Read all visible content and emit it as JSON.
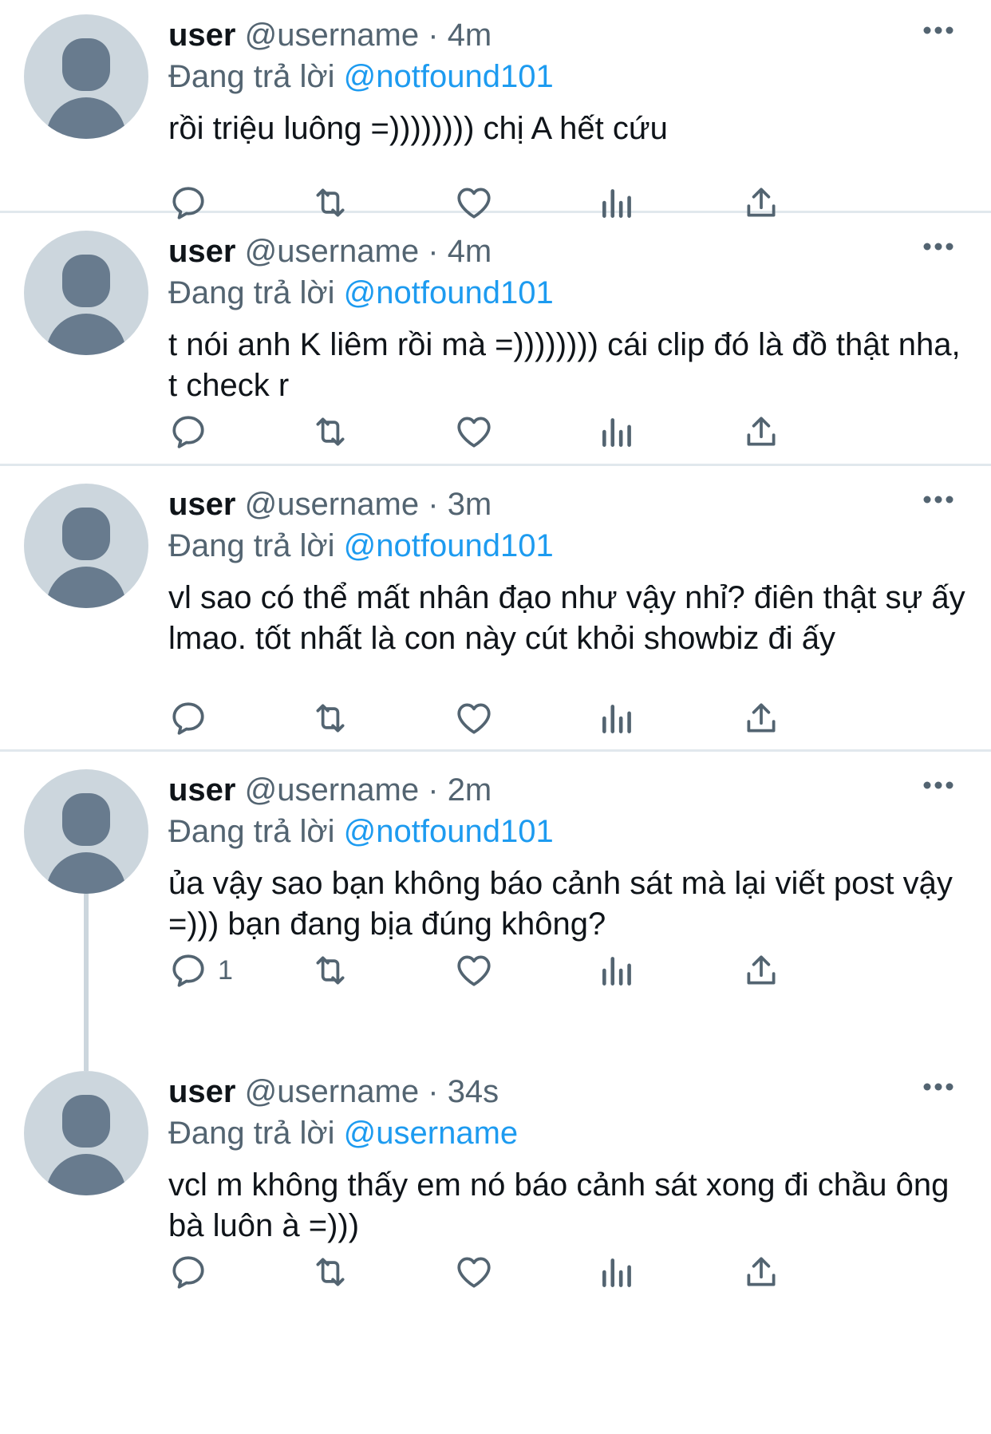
{
  "tweets": [
    {
      "name": "user",
      "handle": "@username",
      "separator": "·",
      "time": "4m",
      "reply_prefix": "Đang trả lời",
      "reply_to": "@notfound101",
      "text": "rồi triệu luông =)))))))) chị A hết cứu",
      "reply_count": ""
    },
    {
      "name": "user",
      "handle": "@username",
      "separator": "·",
      "time": "4m",
      "reply_prefix": "Đang trả lời",
      "reply_to": "@notfound101",
      "text": "t nói anh K liêm rồi mà =)))))))) cái clip đó là đồ thật nha, t check r",
      "reply_count": ""
    },
    {
      "name": "user",
      "handle": "@username",
      "separator": "·",
      "time": "3m",
      "reply_prefix": "Đang trả lời",
      "reply_to": "@notfound101",
      "text": "vl sao có thể mất nhân đạo như vậy nhỉ? điên thật sự ấy lmao. tốt nhất là con này cút khỏi showbiz đi ấy",
      "reply_count": ""
    },
    {
      "name": "user",
      "handle": "@username",
      "separator": "·",
      "time": "2m",
      "reply_prefix": "Đang trả lời",
      "reply_to": "@notfound101",
      "text": "ủa vậy sao bạn không báo cảnh sát mà lại viết post vậy =))) bạn đang bịa đúng không?",
      "reply_count": "1"
    },
    {
      "name": "user",
      "handle": "@username",
      "separator": "·",
      "time": "34s",
      "reply_prefix": "Đang trả lời",
      "reply_to": "@username",
      "text": "vcl m không thấy em nó báo cảnh sát xong đi chầu ông bà luôn à =)))",
      "reply_count": ""
    }
  ],
  "icons": {
    "reply": "reply-icon",
    "retweet": "retweet-icon",
    "like": "like-icon",
    "views": "views-icon",
    "share": "share-icon",
    "more": "more-icon"
  },
  "colors": {
    "link": "#1d9bf0",
    "secondary_text": "#536471",
    "avatar_bg": "#ccd6dd",
    "avatar_fg": "#687b8e",
    "divider": "#e1e8ed"
  }
}
